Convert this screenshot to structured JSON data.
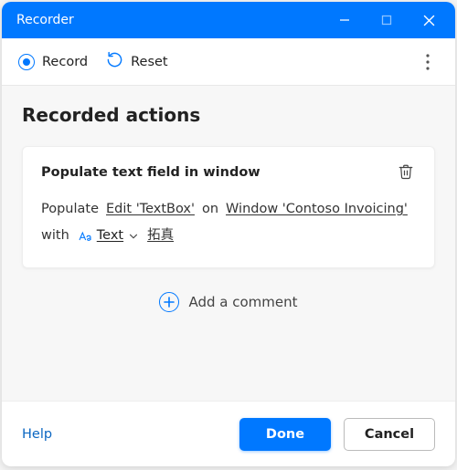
{
  "titlebar": {
    "title": "Recorder"
  },
  "toolbar": {
    "record_label": "Record",
    "reset_label": "Reset"
  },
  "content": {
    "section_title": "Recorded actions",
    "action": {
      "title": "Populate text field in window",
      "fragment_populate": "Populate",
      "element_link": "Edit 'TextBox'",
      "fragment_on": "on",
      "window_link": "Window 'Contoso Invoicing'",
      "fragment_with": "with",
      "type_label": "Text",
      "value_link": "拓真"
    },
    "add_comment_label": "Add a comment"
  },
  "footer": {
    "help_label": "Help",
    "done_label": "Done",
    "cancel_label": "Cancel"
  }
}
